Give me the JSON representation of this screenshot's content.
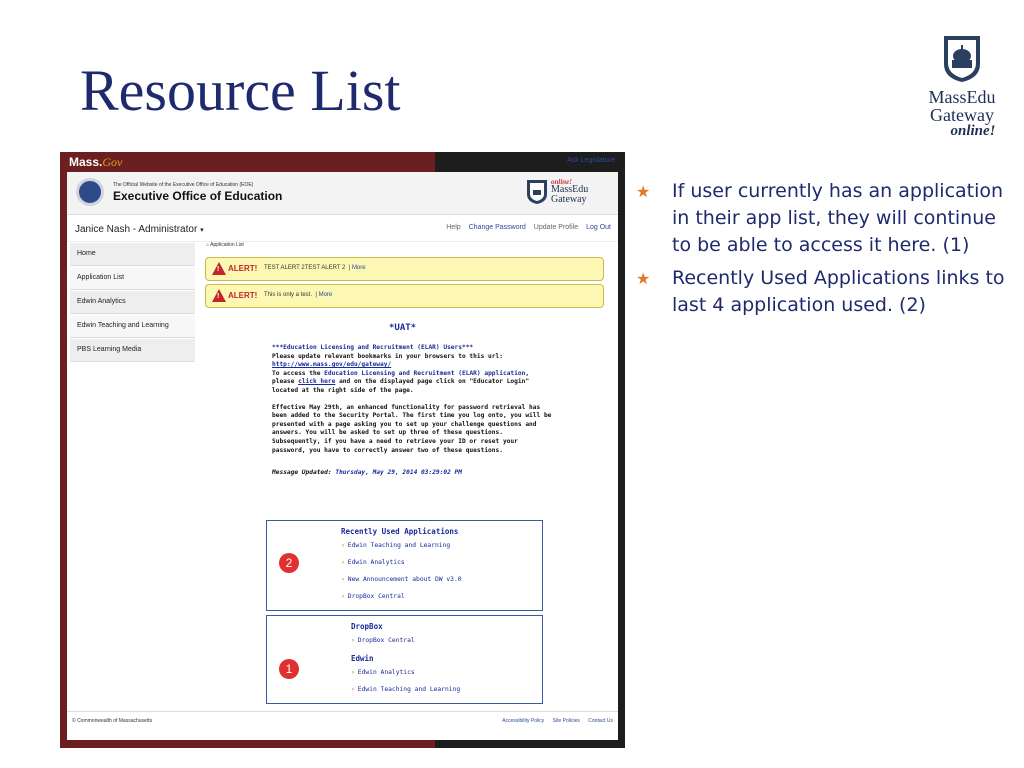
{
  "slide": {
    "title": "Resource List",
    "bullets": [
      "If user currently has an application in their app list, they will continue to be able to access it here. (1)",
      "Recently Used Applications links to last 4 application used. (2)"
    ],
    "bullet_icon": "star-bullet-icon"
  },
  "logo": {
    "line1": "MassEdu",
    "line2": "Gateway",
    "line3": "online!"
  },
  "colors": {
    "title": "#1f2a6e",
    "bullet": "#e07a2a",
    "frame": "#6b1f21",
    "alert_bg": "#fcf8b4",
    "link": "#2c4a9a"
  },
  "screenshot": {
    "topbar": {
      "brand_main": "Mass.",
      "brand_sub": "Gov",
      "top_link": "Ask Legislature"
    },
    "header": {
      "subtitle": "The Official Website of the Executive Office of Education (EOE)",
      "title": "Executive Office of Education",
      "mini_logo_top": "online!",
      "mini_logo_l1": "MassEdu",
      "mini_logo_l2": "Gateway"
    },
    "user": {
      "name": "Janice Nash - Administrator",
      "caret": "▾"
    },
    "usernav": [
      "Help",
      "Change Password",
      "Update Profile",
      "Log Out"
    ],
    "sidebar": [
      "Home",
      "Application List",
      "Edwin Analytics",
      "Edwin Teaching and Learning",
      "PBS Learning Media"
    ],
    "breadcrumb": "⌂ Application List",
    "alerts": [
      {
        "tag": "ALERT!",
        "text": "TEST ALERT 2TEST ALERT 2",
        "more": "More"
      },
      {
        "tag": "ALERT!",
        "text": "This is only a test.",
        "more": "More"
      }
    ],
    "uat": "*UAT*",
    "message": {
      "p1_title": "***Education Licensing and Recruitment (ELAR) Users***",
      "p1_line2": "Please update relevant bookmarks in your browsers to this url:",
      "p1_url": "http://www.mass.gov/edu/gateway/",
      "p1_a": "To access the ",
      "p1_b": "Education Licensing and Recruitment (ELAR) application",
      "p1_c": ", please ",
      "p1_d": "click here",
      "p1_e": " and on the displayed page click on \"Educator Login\" located at the right side of the page.",
      "p2": "Effective May 29th, an enhanced functionality for password retrieval has been added to the Security Portal. The first time you log onto, you will be presented with a page asking you to set up your challenge questions and answers. You will be asked to set up three of these questions. Subsequently, if you have a need to retrieve your ID or reset your password, you have to correctly answer two of these questions.",
      "updated_label": "Message Updated: ",
      "updated_value": "Thursday, May 29, 2014 03:29:02 PM"
    },
    "recent": {
      "title": "Recently Used Applications",
      "items": [
        "Edwin Teaching and Learning",
        "Edwin Analytics",
        "New Announcement about DW v3.0",
        "DropBox Central"
      ],
      "badge": "2"
    },
    "apps": {
      "group1_title": "DropBox",
      "group1_items": [
        "DropBox Central"
      ],
      "group2_title": "Edwin",
      "group2_items": [
        "Edwin Analytics",
        "Edwin Teaching and Learning"
      ],
      "badge": "1"
    },
    "footer": {
      "left": "© Commonwealth of Massachusetts",
      "links": [
        "Accessibility Policy",
        "Site Policies",
        "Contact Us"
      ]
    }
  }
}
